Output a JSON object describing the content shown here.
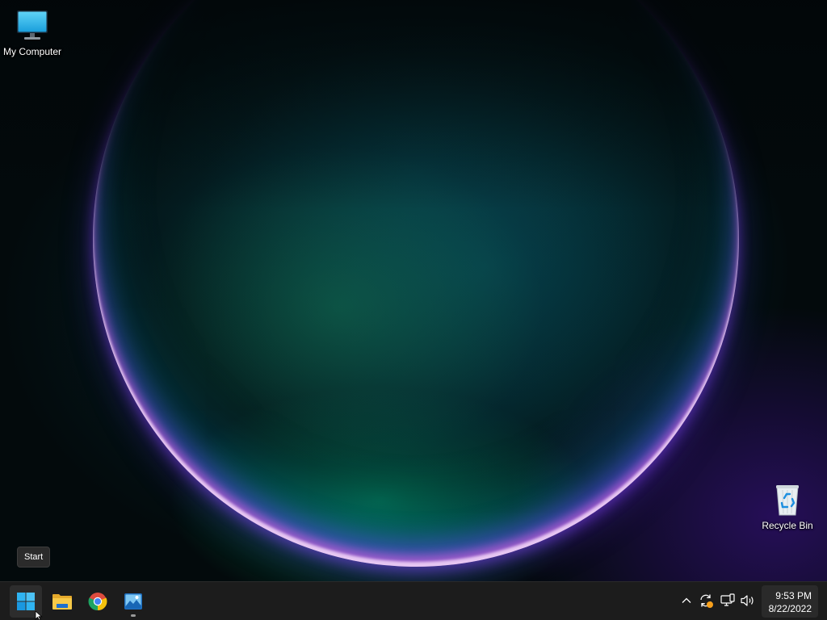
{
  "desktop": {
    "icons": [
      {
        "label": "My Computer",
        "icon": "monitor-icon"
      },
      {
        "label": "Recycle Bin",
        "icon": "recycle-bin-icon"
      }
    ]
  },
  "tooltip": {
    "text": "Start"
  },
  "taskbar": {
    "pinned": [
      {
        "icon": "windows-start-icon",
        "active": true
      },
      {
        "icon": "file-explorer-icon",
        "running": false
      },
      {
        "icon": "chrome-icon",
        "running": false
      },
      {
        "icon": "photos-icon",
        "running": true
      }
    ],
    "tray": [
      "chevron-up-icon",
      "windows-update-icon",
      "network-icon",
      "volume-icon"
    ]
  },
  "clock": {
    "time": "9:53 PM",
    "date": "8/22/2022"
  },
  "colors": {
    "taskbar_bg": "#1c1c1c",
    "accent": "#2fb4f2",
    "update_badge": "#f7a01c"
  }
}
